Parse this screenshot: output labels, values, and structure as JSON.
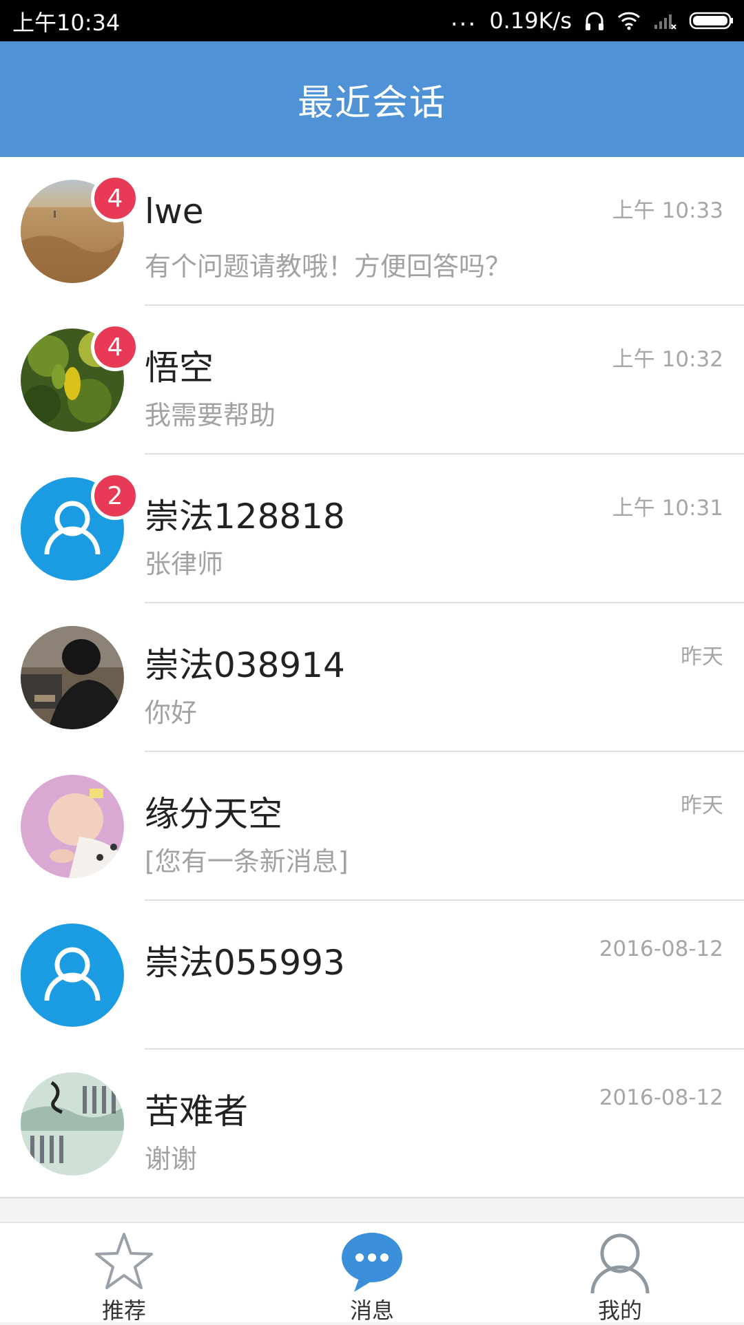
{
  "status_bar": {
    "time": "上午10:34",
    "dots": "...",
    "speed": "0.19K/s",
    "icons": [
      "headphones-icon",
      "wifi-icon",
      "signal-icon",
      "battery-icon"
    ]
  },
  "header": {
    "title": "最近会话"
  },
  "conversations": [
    {
      "name": "lwe",
      "preview": "有个问题请教哦！方便回答吗？",
      "time": "上午 10:33",
      "badge": "4",
      "avatar": "photo-field"
    },
    {
      "name": "悟空",
      "preview": "我需要帮助",
      "time": "上午 10:32",
      "badge": "4",
      "avatar": "photo-leaves"
    },
    {
      "name": "崇法128818",
      "preview": "张律师",
      "time": "上午 10:31",
      "badge": "2",
      "avatar": "default-user"
    },
    {
      "name": "崇法038914",
      "preview": "你好",
      "time": "昨天",
      "badge": "",
      "avatar": "photo-person"
    },
    {
      "name": "缘分天空",
      "preview": "[您有一条新消息]",
      "time": "昨天",
      "badge": "",
      "avatar": "photo-baby"
    },
    {
      "name": "崇法055993",
      "preview": "",
      "time": "2016-08-12",
      "badge": "",
      "avatar": "default-user"
    },
    {
      "name": "苦难者",
      "preview": "谢谢",
      "time": "2016-08-12",
      "badge": "",
      "avatar": "photo-calligraphy"
    }
  ],
  "bottom_nav": [
    {
      "label": "推荐",
      "icon": "star-icon",
      "active": false
    },
    {
      "label": "消息",
      "icon": "chat-bubble-icon",
      "active": true
    },
    {
      "label": "我的",
      "icon": "person-icon",
      "active": false
    }
  ],
  "colors": {
    "header": "#4f93d6",
    "badge": "#e83a56",
    "default_avatar": "#1b9be2",
    "active_nav": "#3a8fd8"
  }
}
